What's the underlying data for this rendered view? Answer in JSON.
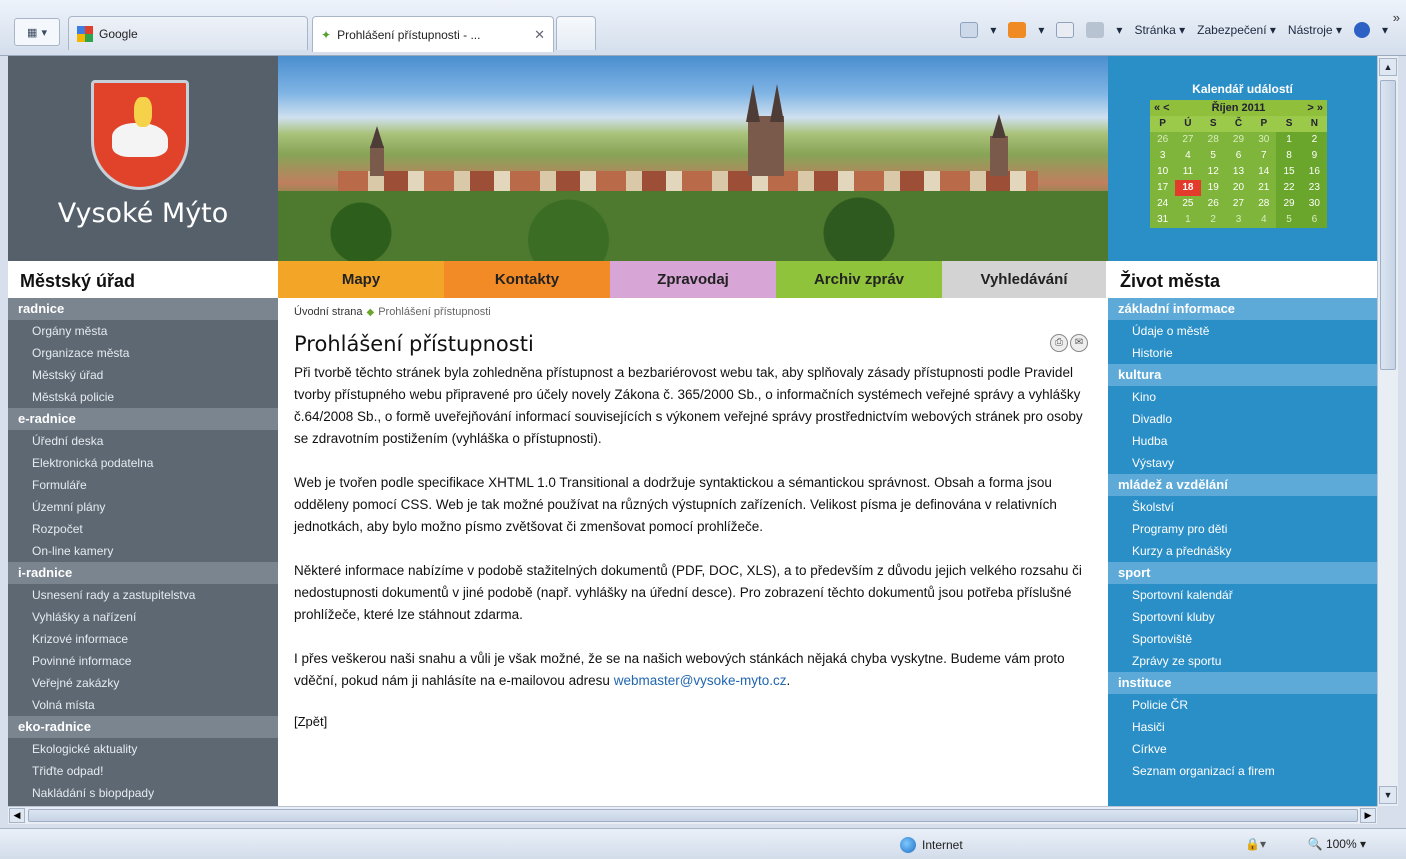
{
  "browser": {
    "tabs": [
      {
        "label": "Google"
      },
      {
        "label": "Prohlášení přístupnosti - ..."
      }
    ],
    "commands": {
      "page": "Stránka ▾",
      "security": "Zabezpečení ▾",
      "tools": "Nástroje ▾"
    },
    "status": {
      "zone": "Internet",
      "zoom": "100%"
    }
  },
  "site": {
    "city": "Vysoké Mýto",
    "calendar": {
      "title": "Kalendář událostí",
      "prev": "« <",
      "month": "Říjen 2011",
      "next": "> »",
      "day_names": [
        "P",
        "Ú",
        "S",
        "Č",
        "P",
        "S",
        "N"
      ],
      "weeks": [
        [
          "26",
          "27",
          "28",
          "29",
          "30",
          "1",
          "2"
        ],
        [
          "3",
          "4",
          "5",
          "6",
          "7",
          "8",
          "9"
        ],
        [
          "10",
          "11",
          "12",
          "13",
          "14",
          "15",
          "16"
        ],
        [
          "17",
          "18",
          "19",
          "20",
          "21",
          "22",
          "23"
        ],
        [
          "24",
          "25",
          "26",
          "27",
          "28",
          "29",
          "30"
        ],
        [
          "31",
          "1",
          "2",
          "3",
          "4",
          "5",
          "6"
        ]
      ],
      "today": "18"
    },
    "left_title": "Městský úřad",
    "right_title": "Život města",
    "nav": [
      {
        "label": "Mapy",
        "color": "#f3a528"
      },
      {
        "label": "Kontakty",
        "color": "#f28a26"
      },
      {
        "label": "Zpravodaj",
        "color": "#d7a5d6"
      },
      {
        "label": "Archiv zpráv",
        "color": "#8fc33c"
      },
      {
        "label": "Vyhledávání",
        "color": "#d3d3d3"
      }
    ],
    "left_menu": [
      {
        "heading": "radnice",
        "items": [
          "Orgány města",
          "Organizace města",
          "Městský úřad",
          "Městská policie"
        ]
      },
      {
        "heading": "e-radnice",
        "items": [
          "Úřední deska",
          "Elektronická podatelna",
          "Formuláře",
          "Územní plány",
          "Rozpočet",
          "On-line kamery"
        ]
      },
      {
        "heading": "i-radnice",
        "items": [
          "Usnesení rady a zastupitelstva",
          "Vyhlášky a nařízení",
          "Krizové informace",
          "Povinné informace",
          "Veřejné zakázky",
          "Volná místa"
        ]
      },
      {
        "heading": "eko-radnice",
        "items": [
          "Ekologické aktuality",
          "Třiďte odpad!",
          "Nakládání s biopdpady"
        ]
      }
    ],
    "right_menu": [
      {
        "heading": "základní informace",
        "items": [
          "Údaje o městě",
          "Historie"
        ]
      },
      {
        "heading": "kultura",
        "items": [
          "Kino",
          "Divadlo",
          "Hudba",
          "Výstavy"
        ]
      },
      {
        "heading": "mládež a vzdělání",
        "items": [
          "Školství",
          "Programy pro děti",
          "Kurzy a přednášky"
        ]
      },
      {
        "heading": "sport",
        "items": [
          "Sportovní kalendář",
          "Sportovní kluby",
          "Sportoviště",
          "Zprávy ze sportu"
        ]
      },
      {
        "heading": "instituce",
        "items": [
          "Policie ČR",
          "Hasiči",
          "Církve",
          "Seznam organizací a firem"
        ]
      }
    ]
  },
  "content": {
    "breadcrumb": [
      "Úvodní strana",
      "Prohlášení přístupnosti"
    ],
    "title": "Prohlášení přístupnosti",
    "paragraphs": [
      "Při tvorbě těchto stránek byla zohledněna přístupnost a bezbariérovost webu tak, aby splňovaly zásady přístupnosti podle Pravidel tvorby přístupného webu připravené pro účely novely Zákona č. 365/2000 Sb., o informačních systémech veřejné správy a vyhlášky č.64/2008 Sb., o formě uveřejňování informací souvisejících s výkonem veřejné správy prostřednictvím webových stránek pro osoby se zdravotním postižením (vyhláška o přístupnosti).",
      "Web je tvořen podle specifikace XHTML 1.0 Transitional a dodržuje syntaktickou a sémantickou správnost. Obsah a forma jsou odděleny pomocí CSS. Web je tak možné používat na různých výstupních zařízeních. Velikost písma je definována v relativních jednotkách, aby bylo možno písmo zvětšovat či zmenšovat pomocí prohlížeče.",
      "Některé informace nabízíme v podobě stažitelných dokumentů (PDF, DOC, XLS), a to především z důvodu jejich velkého rozsahu či nedostupnosti dokumentů v jiné podobě (např. vyhlášky na úřední desce). Pro zobrazení těchto dokumentů jsou potřeba příslušné prohlížeče, které lze stáhnout zdarma."
    ],
    "last_paragraph": "I přes veškerou naši snahu a vůli je však možné, že se na našich webových stánkách nějaká chyba vyskytne. Budeme vám proto vděční, pokud nám ji nahlásíte na e-mailovou adresu ",
    "email": "webmaster@vysoke-myto.cz",
    "last_suffix": ".",
    "back": "[Zpět]"
  }
}
